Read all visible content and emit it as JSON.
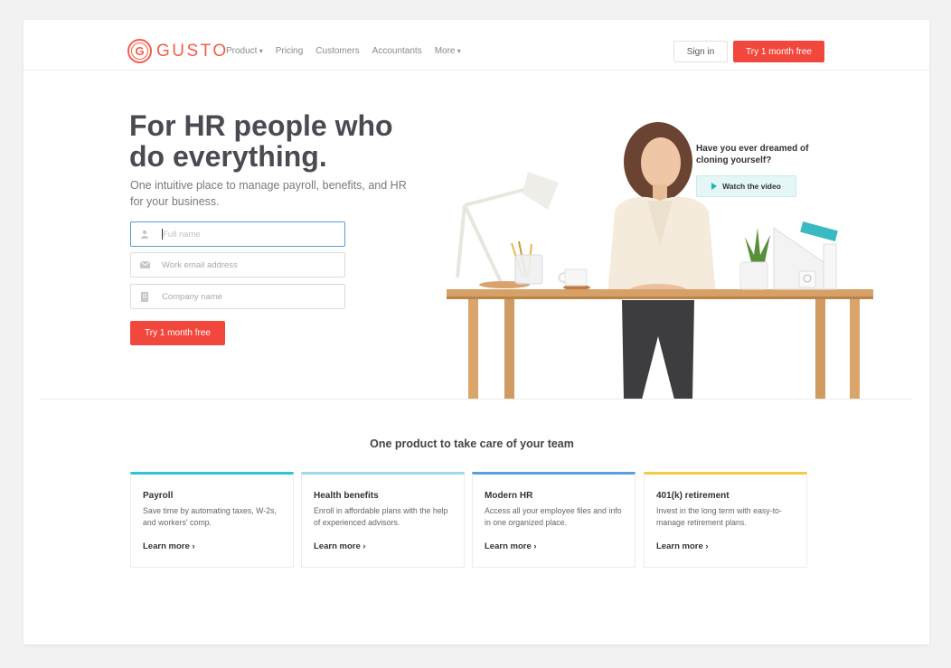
{
  "brand": {
    "name": "GUSTO",
    "mark_letter": "G",
    "accent": "#f2473c",
    "logo_color": "#f45d48"
  },
  "nav": {
    "links": [
      {
        "label": "Product",
        "dropdown": true
      },
      {
        "label": "Pricing",
        "dropdown": false
      },
      {
        "label": "Customers",
        "dropdown": false
      },
      {
        "label": "Accountants",
        "dropdown": false
      },
      {
        "label": "More",
        "dropdown": true
      }
    ],
    "signin_label": "Sign in",
    "cta_label": "Try 1 month free"
  },
  "hero": {
    "title": "For HR people who do everything.",
    "subtitle": "One intuitive place to manage payroll, benefits, and HR for your business.",
    "fields": [
      {
        "placeholder": "Full name",
        "icon": "user-icon"
      },
      {
        "placeholder": "Work email address",
        "icon": "mail-icon"
      },
      {
        "placeholder": "Company name",
        "icon": "building-icon"
      }
    ],
    "cta_label": "Try 1 month free",
    "video_prompt": "Have you ever dreamed of cloning yourself?",
    "video_label": "Watch the video",
    "video_accent": "#1fb5b0"
  },
  "products": {
    "title": "One product to take care of your team",
    "cards": [
      {
        "title": "Payroll",
        "text": "Save time by automating taxes, W-2s, and workers' comp.",
        "link": "Learn more ›",
        "color": "#2ec4d4"
      },
      {
        "title": "Health benefits",
        "text": "Enroll in affordable plans with the help of experienced advisors.",
        "link": "Learn more ›",
        "color": "#9fd9ec"
      },
      {
        "title": "Modern HR",
        "text": "Access all your employee files and info in one organized place.",
        "link": "Learn more ›",
        "color": "#5aa0dc"
      },
      {
        "title": "401(k) retirement",
        "text": "Invest in the long term with easy-to-manage retirement plans.",
        "link": "Learn more ›",
        "color": "#f7c948"
      }
    ]
  }
}
